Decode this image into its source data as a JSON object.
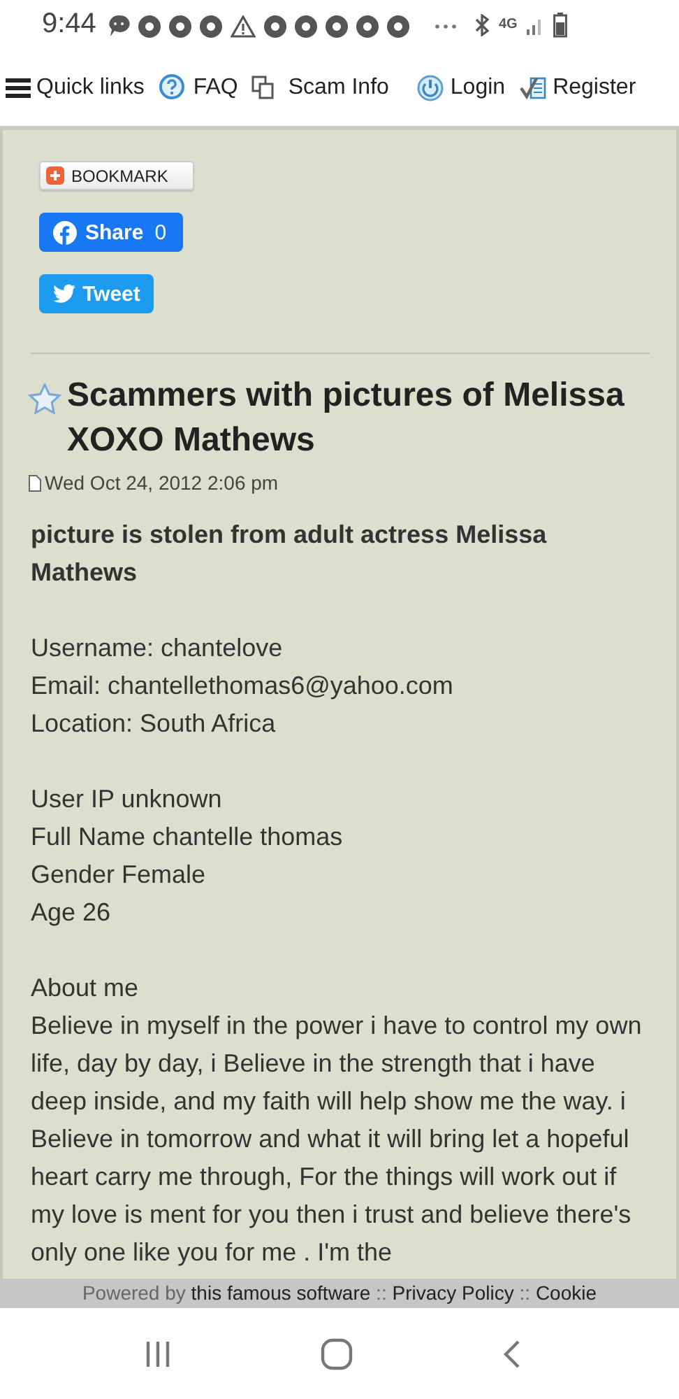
{
  "status_bar": {
    "time": "9:44",
    "network": "4G"
  },
  "nav": {
    "items": [
      {
        "label": "Quick links"
      },
      {
        "label": "FAQ"
      },
      {
        "label": "Scam Info"
      },
      {
        "label": "Login"
      },
      {
        "label": "Register"
      }
    ]
  },
  "post": {
    "bookmark": "BOOKMARK",
    "share": {
      "label": "Share",
      "count": "0"
    },
    "tweet": "Tweet",
    "title": "Scammers with pictures of Melissa XOXO Mathews",
    "date": "Wed Oct 24, 2012 2:06 pm",
    "lead": "picture is stolen from adult actress Melissa Mathews",
    "groups": [
      [
        "Username: chantelove",
        "Email: chantellethomas6@yahoo.com",
        "Location: South Africa"
      ],
      [
        "User IP unknown",
        "Full Name chantelle thomas",
        "Gender Female",
        "Age 26"
      ],
      [
        "About me",
        "Believe in myself in the power i have to control my own life, day by day, i Believe in the strength that i have deep inside, and my faith will help show me the way. i Believe in tomorrow and what it will bring let a hopeful heart carry me through, For the things will work out if my love is ment for you then i trust and believe there's only one like you for me . I'm the"
      ]
    ]
  },
  "footer": {
    "prefix": "Powered by",
    "links": [
      "this famous software",
      "Privacy Policy",
      "Cookie"
    ],
    "separator": "::"
  }
}
